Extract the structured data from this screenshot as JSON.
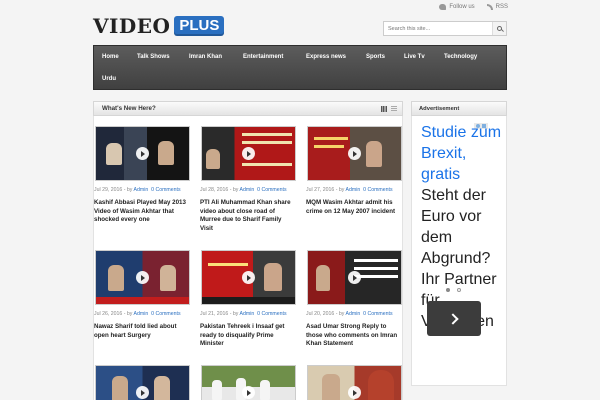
{
  "brand": {
    "word": "VIDEO",
    "badge": "PLUS"
  },
  "toplinks": {
    "follow": "Follow us",
    "rss": "RSS"
  },
  "search": {
    "placeholder": "Search this site..."
  },
  "nav": {
    "items": [
      "Home",
      "Talk Shows",
      "Imran Khan",
      "Entertainment",
      "Express news",
      "Sports",
      "Live Tv",
      "Technology",
      "Urdu"
    ]
  },
  "main": {
    "heading": "What's New Here?",
    "posts": [
      {
        "date": "Jul 29, 2016",
        "by": "by",
        "author": "Admin",
        "comments": "0 Comments",
        "title": "Kashif Abbasi Played May 2013 Video of Wasim Akhtar that shocked every one"
      },
      {
        "date": "Jul 28, 2016",
        "by": "by",
        "author": "Admin",
        "comments": "0 Comments",
        "title": "PTI Ali Muhammad Khan share video about close road of Murree due to Sharif Family Visit"
      },
      {
        "date": "Jul 27, 2016",
        "by": "by",
        "author": "Admin",
        "comments": "0 Comments",
        "title": "MQM Wasim Akhtar admit his crime on 12 May 2007 incident"
      },
      {
        "date": "Jul 26, 2016",
        "by": "by",
        "author": "Admin",
        "comments": "0 Comments",
        "title": "Nawaz Sharif told lied about open heart Surgery"
      },
      {
        "date": "Jul 21, 2016",
        "by": "by",
        "author": "Admin",
        "comments": "0 Comments",
        "title": "Pakistan Tehreek i Insaaf get ready to disqualify Prime Minister"
      },
      {
        "date": "Jul 20, 2016",
        "by": "by",
        "author": "Admin",
        "comments": "0 Comments",
        "title": "Asad Umar Strong Reply to those who comments on Imran Khan Statement"
      },
      {
        "date": "",
        "by": "",
        "author": "",
        "comments": "",
        "title": ""
      },
      {
        "date": "",
        "by": "",
        "author": "",
        "comments": "",
        "title": ""
      },
      {
        "date": "",
        "by": "",
        "author": "",
        "comments": "",
        "title": ""
      }
    ]
  },
  "sidebar": {
    "heading": "Advertisement",
    "ad": {
      "headline": "Studie zum Brexit, gratis",
      "body": "Steht der Euro vor dem Abgrund? Ihr Partner für Vermögen"
    }
  },
  "colors": {
    "accent": "#2a6fc0",
    "nav_bg": "#4a4a4a",
    "ad_link": "#1a73e8"
  }
}
